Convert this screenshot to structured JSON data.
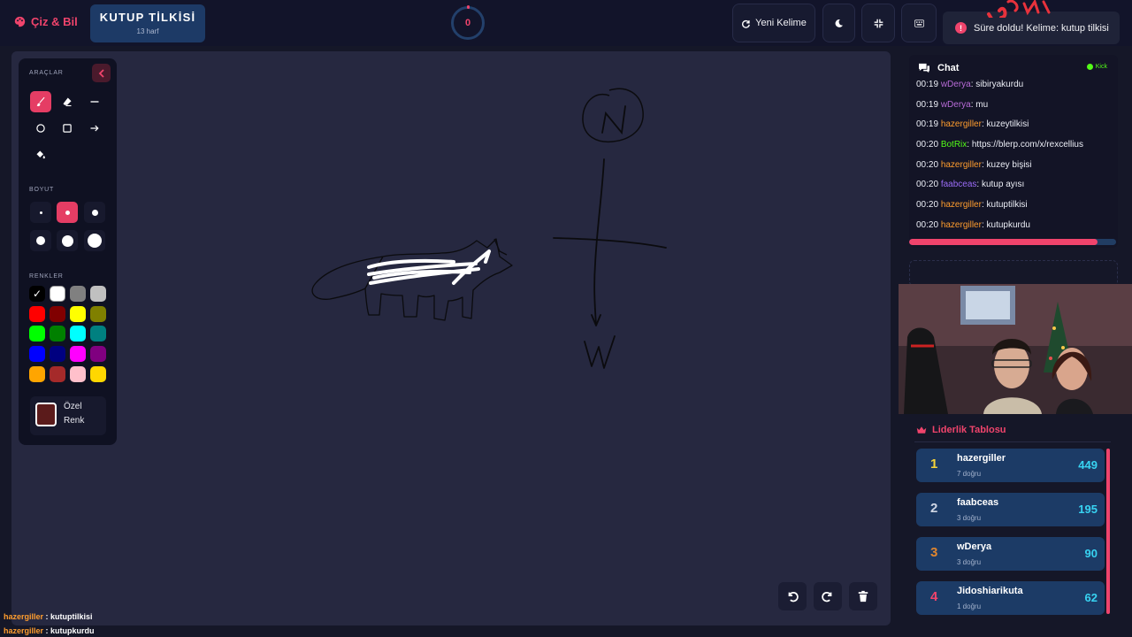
{
  "app": {
    "name": "Çiz & Bil"
  },
  "word": {
    "title": "KUTUP TİLKİSİ",
    "length_label": "13 harf"
  },
  "timer": {
    "value": "0"
  },
  "toolbar": {
    "new_word_label": "Yeni Kelime",
    "theme_icon": "moon-icon",
    "fullscreen_icon": "compress-icon",
    "keyboard_icon": "keyboard-icon"
  },
  "toast": {
    "text": "Süre doldu! Kelime: kutup tilkisi"
  },
  "tools_panel": {
    "tools_label": "ARAÇLAR",
    "tools": [
      "brush-icon",
      "eraser-icon",
      "line-icon",
      "circle-icon",
      "square-icon",
      "arrow-icon",
      "fill-icon"
    ],
    "size_label": "BOYUT",
    "colors_label": "RENKLER",
    "selected_color": "#000000",
    "colors": [
      "#000000",
      "#ffffff",
      "#808080",
      "#c0c0c0",
      "#ff0000",
      "#800000",
      "#ffff00",
      "#808000",
      "#00ff00",
      "#008000",
      "#00ffff",
      "#008080",
      "#0000ff",
      "#000080",
      "#ff00ff",
      "#800080",
      "#ffa500",
      "#a52a2a",
      "#ffc0cb",
      "#ffd700"
    ],
    "custom_color_label": "Özel Renk",
    "custom_color": "#5b1b1b"
  },
  "chat": {
    "title": "Chat",
    "platform": "Kick",
    "messages": [
      {
        "time": "00:19",
        "user": "wDerya",
        "color": "#b86bd8",
        "text": "sibiryakurdu"
      },
      {
        "time": "00:19",
        "user": "wDerya",
        "color": "#b86bd8",
        "text": "mu"
      },
      {
        "time": "00:19",
        "user": "hazergiller",
        "color": "#ff9d2e",
        "text": "kuzeytilkisi"
      },
      {
        "time": "00:20",
        "user": "BotRix",
        "color": "#53fc18",
        "text": "https://blerp.com/x/rexcellius"
      },
      {
        "time": "00:20",
        "user": "hazergiller",
        "color": "#ff9d2e",
        "text": "kuzey bişisi"
      },
      {
        "time": "00:20",
        "user": "faabceas",
        "color": "#9b6cf7",
        "text": "kutup ayısı"
      },
      {
        "time": "00:20",
        "user": "hazergiller",
        "color": "#ff9d2e",
        "text": "kutuptilkisi"
      },
      {
        "time": "00:20",
        "user": "hazergiller",
        "color": "#ff9d2e",
        "text": "kutupkurdu"
      }
    ],
    "progress": 0.91
  },
  "leaderboard": {
    "title": "Liderlik Tablosu",
    "entries": [
      {
        "rank": "1",
        "name": "hazergiller",
        "correct": "7 doğru",
        "score": "449",
        "rank_color": "#f5d33a"
      },
      {
        "rank": "2",
        "name": "faabceas",
        "correct": "3 doğru",
        "score": "195",
        "rank_color": "#cfd6e4"
      },
      {
        "rank": "3",
        "name": "wDerya",
        "correct": "3 doğru",
        "score": "90",
        "rank_color": "#e0862f"
      },
      {
        "rank": "4",
        "name": "Jidoshiarikuta",
        "correct": "1 doğru",
        "score": "62",
        "rank_color": "#f0446c"
      }
    ]
  },
  "bottom_chat": [
    {
      "user": "hazergiller",
      "text": "kutuptilkisi"
    },
    {
      "user": "hazergiller",
      "text": "kutupkurdu"
    }
  ]
}
